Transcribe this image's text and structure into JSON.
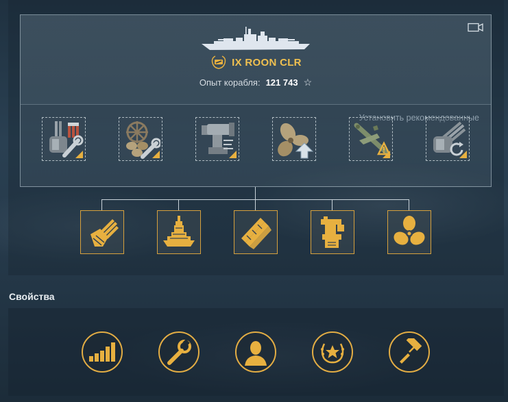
{
  "ship": {
    "tier": "IX",
    "name": "ROON CLR",
    "title": "IX ROON CLR",
    "xp_label": "Опыт корабля:",
    "xp_value": "121 743"
  },
  "modules": {
    "recommend_label": "Установить рекомендованные",
    "slots": [
      {
        "icon": "main-battery-modification-icon"
      },
      {
        "icon": "propulsion-repair-modification-icon"
      },
      {
        "icon": "fire-control-modification-icon"
      },
      {
        "icon": "propulsion-boost-modification-icon"
      },
      {
        "icon": "aircraft-warning-modification-icon"
      },
      {
        "icon": "turret-reload-modification-icon"
      }
    ]
  },
  "upgrades": [
    {
      "icon": "main-battery-turret-icon"
    },
    {
      "icon": "hull-icon"
    },
    {
      "icon": "torpedo-tubes-icon"
    },
    {
      "icon": "fire-control-system-icon"
    },
    {
      "icon": "engine-propeller-icon"
    }
  ],
  "properties": {
    "title": "Свойства",
    "items": [
      {
        "icon": "performance-bars-icon"
      },
      {
        "icon": "wrench-icon"
      },
      {
        "icon": "commander-icon"
      },
      {
        "icon": "laurel-star-icon"
      },
      {
        "icon": "paint-roller-icon"
      }
    ]
  },
  "colors": {
    "accent_gold": "#e7b040",
    "title_gold": "#f0c050"
  }
}
